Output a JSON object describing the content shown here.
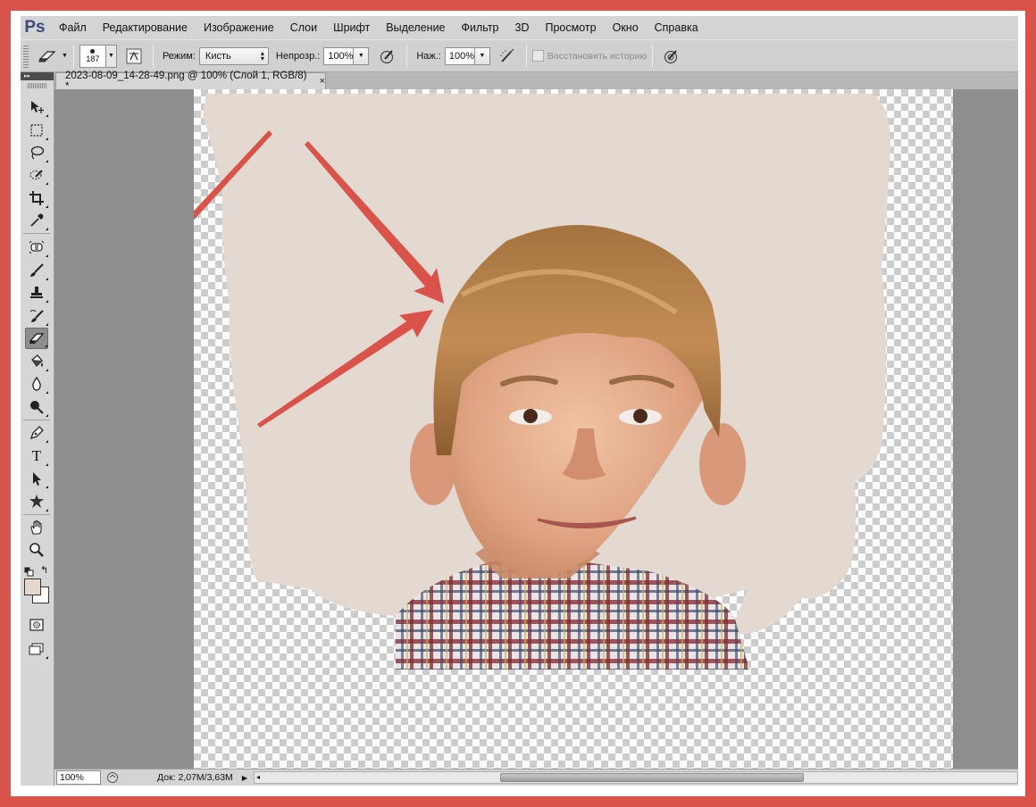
{
  "app": {
    "logo": "Ps"
  },
  "menu": [
    "Файл",
    "Редактирование",
    "Изображение",
    "Слои",
    "Шрифт",
    "Выделение",
    "Фильтр",
    "3D",
    "Просмотр",
    "Окно",
    "Справка"
  ],
  "options": {
    "brush_size": "187",
    "mode_label": "Режим:",
    "mode_value": "Кисть",
    "opacity_label": "Непрозр.:",
    "opacity_value": "100%",
    "flow_label": "Наж.:",
    "flow_value": "100%",
    "restore_history_label": "Восстановить историю",
    "restore_history_checked": false
  },
  "toolbar": {
    "header_glyph": "▸▸",
    "tools": [
      {
        "name": "move-tool",
        "icon": "move-icon"
      },
      {
        "name": "marquee-tool",
        "icon": "marquee-icon"
      },
      {
        "name": "lasso-tool",
        "icon": "lasso-icon"
      },
      {
        "name": "quick-selection-tool",
        "icon": "quick-selection-icon"
      },
      {
        "name": "crop-tool",
        "icon": "crop-icon"
      },
      {
        "name": "eyedropper-tool",
        "icon": "eyedropper-icon"
      },
      {
        "name": "spot-healing-tool",
        "icon": "healing-icon"
      },
      {
        "name": "brush-tool",
        "icon": "brush-icon"
      },
      {
        "name": "clone-stamp-tool",
        "icon": "stamp-icon"
      },
      {
        "name": "history-brush-tool",
        "icon": "history-brush-icon"
      },
      {
        "name": "eraser-tool",
        "icon": "eraser-icon",
        "active": true
      },
      {
        "name": "paint-bucket-tool",
        "icon": "paint-bucket-icon"
      },
      {
        "name": "blur-tool",
        "icon": "blur-icon"
      },
      {
        "name": "dodge-tool",
        "icon": "dodge-icon"
      },
      {
        "name": "pen-tool",
        "icon": "pen-icon"
      },
      {
        "name": "type-tool",
        "icon": "type-icon",
        "glyph": "T"
      },
      {
        "name": "path-selection-tool",
        "icon": "path-selection-icon"
      },
      {
        "name": "custom-shape-tool",
        "icon": "custom-shape-icon"
      },
      {
        "name": "hand-tool",
        "icon": "hand-icon"
      },
      {
        "name": "zoom-tool",
        "icon": "zoom-icon"
      }
    ],
    "foreground_color": "#e4d7ce",
    "background_color": "#ffffff"
  },
  "document": {
    "tab_title": "2023-08-09_14-28-49.png @ 100% (Слой 1, RGB/8) *",
    "close_glyph": "×"
  },
  "status": {
    "zoom": "100%",
    "doc_size": "Док: 2,07M/3,63M"
  },
  "colors": {
    "frame_border": "#d9534a",
    "annotation_arrow": "#d9534a",
    "backdrop": "#e4d9d0",
    "menubar": "#d4d4d4",
    "workspace": "#8e8e8e"
  }
}
